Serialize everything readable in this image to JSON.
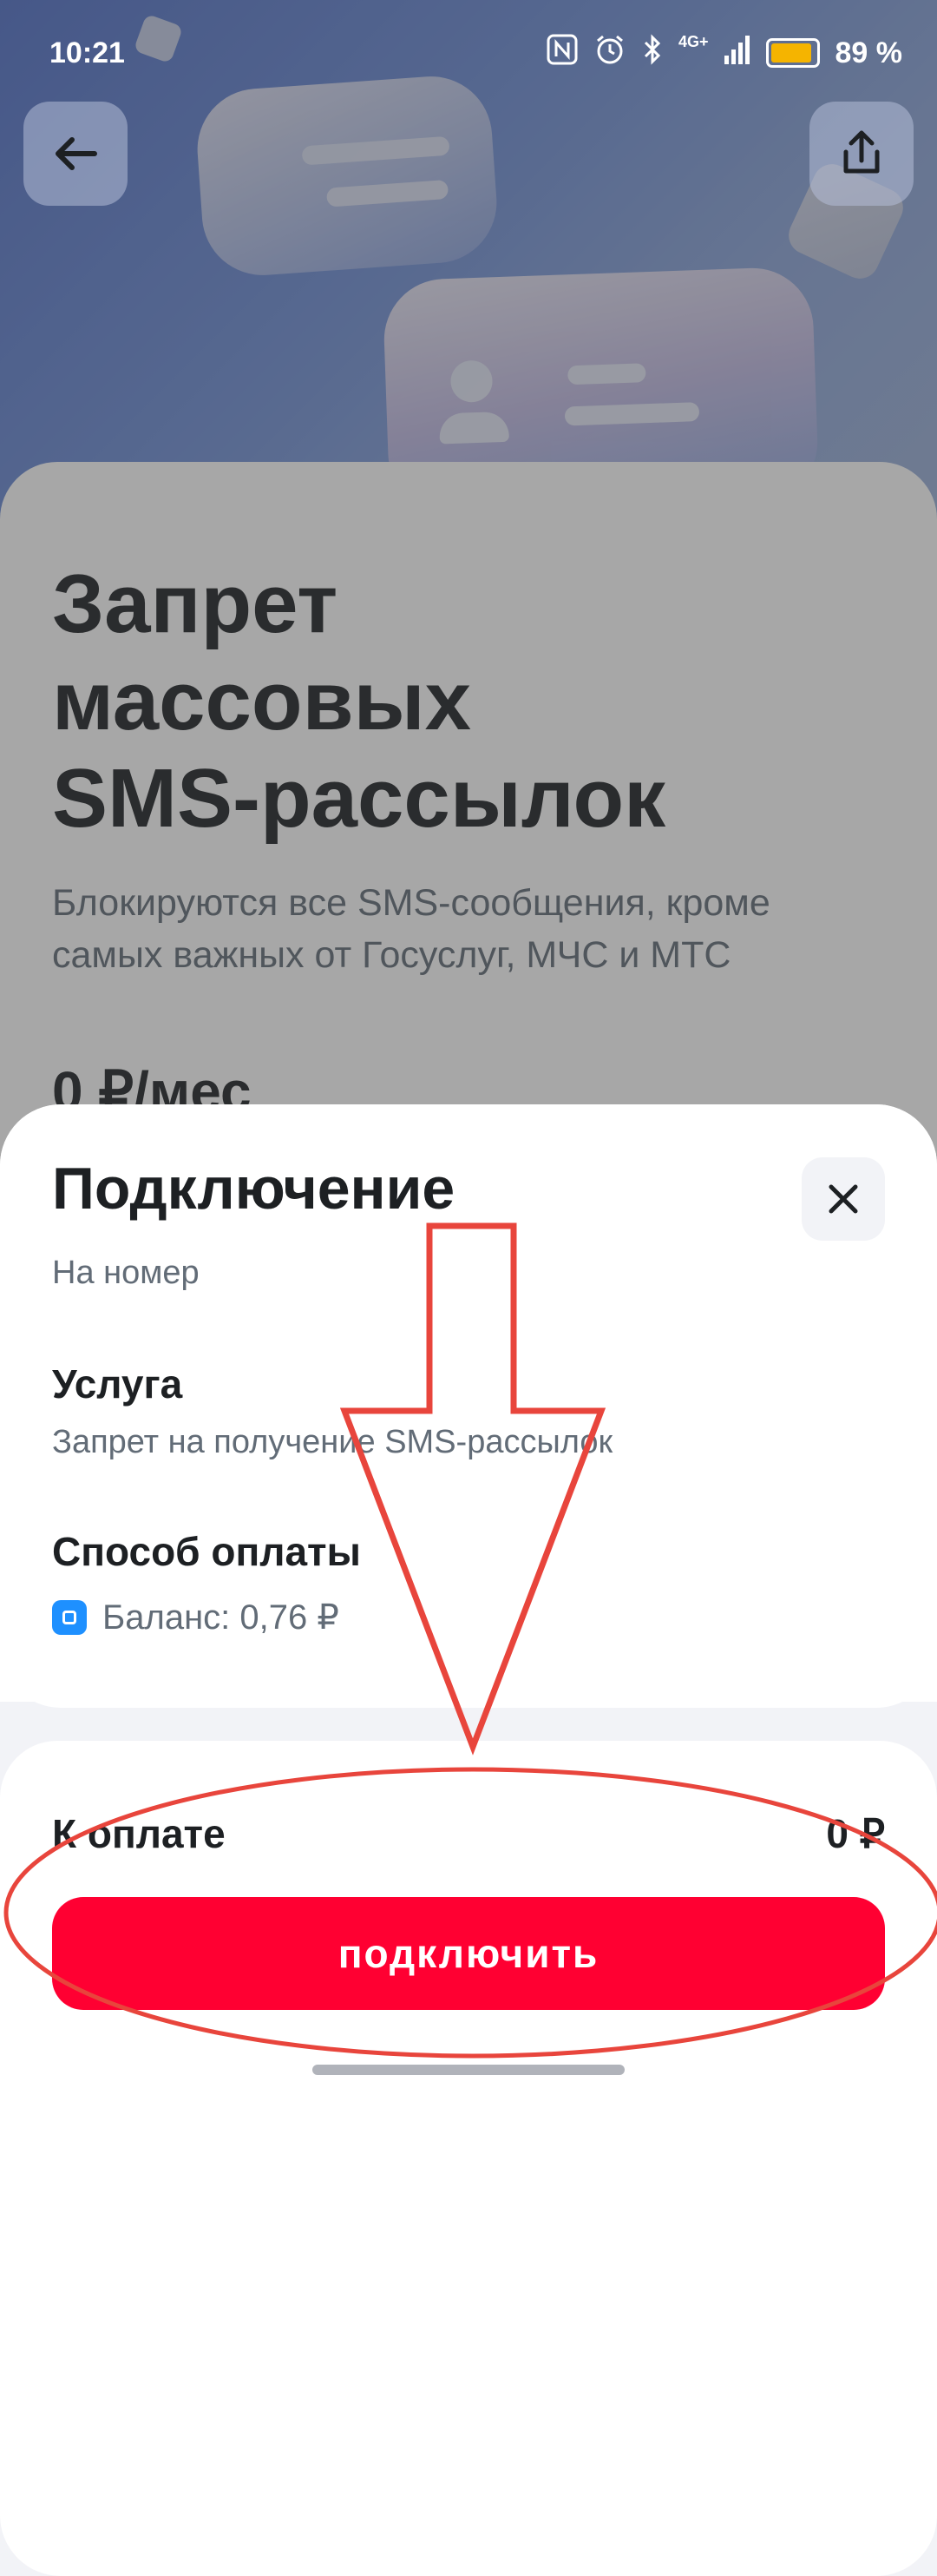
{
  "status_bar": {
    "time": "10:21",
    "network": "4G+",
    "battery_percent": "89 %"
  },
  "hero": {
    "back_icon": "arrow-left-icon",
    "share_icon": "share-icon"
  },
  "service": {
    "title_lines": [
      "Запрет",
      "массовых",
      "SMS-рассылок"
    ],
    "description_lines": [
      "Блокируются все SMS-сообщения, кроме",
      "самых важных от Госуслуг, МЧС и МТС"
    ],
    "price": "0 ₽/мес"
  },
  "sheet": {
    "title": "Подключение",
    "close_icon": "close-icon",
    "number_label": "На номер",
    "service_label": "Услуга",
    "service_value": "Запрет на получение SMS-рассылок",
    "payment_label": "Способ оплаты",
    "balance_text": "Баланс: 0,76 ₽",
    "to_pay_label": "К оплате",
    "to_pay_amount": "0 ₽",
    "cta_label": "подключить"
  },
  "colors": {
    "accent": "#ff0032",
    "annotation": "#e8453c"
  }
}
